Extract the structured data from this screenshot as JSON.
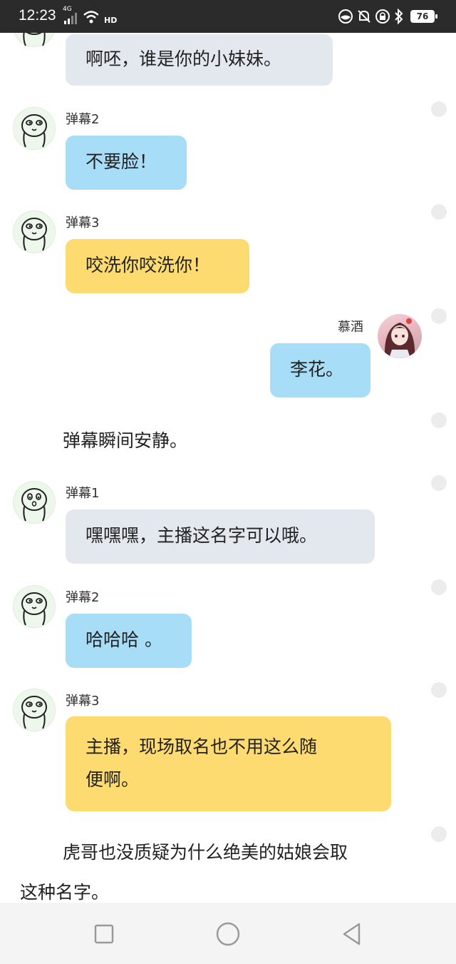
{
  "status_bar": {
    "time": "12:23",
    "network": "4G",
    "hd": "HD",
    "battery": "76"
  },
  "messages": [
    {
      "type": "bubble",
      "side": "left",
      "sender": "",
      "text": "啊呸，谁是你的小妹妹。",
      "color": "gray"
    },
    {
      "type": "bubble",
      "side": "left",
      "sender": "弹幕2",
      "text": "不要脸！",
      "color": "blue"
    },
    {
      "type": "bubble",
      "side": "left",
      "sender": "弹幕3",
      "text": "咬洗你咬洗你！",
      "color": "yellow"
    },
    {
      "type": "bubble",
      "side": "right",
      "sender": "慕酒",
      "text": "李花。",
      "color": "blue"
    },
    {
      "type": "narration",
      "text": "弹幕瞬间安静。"
    },
    {
      "type": "bubble",
      "side": "left",
      "sender": "弹幕1",
      "text": "嘿嘿嘿，主播这名字可以哦。",
      "color": "gray"
    },
    {
      "type": "bubble",
      "side": "left",
      "sender": "弹幕2",
      "text": "哈哈哈 。",
      "color": "blue"
    },
    {
      "type": "bubble",
      "side": "left",
      "sender": "弹幕3",
      "text_line1": "主播，现场取名也不用这么随",
      "text_line2": "便啊。",
      "color": "yellow"
    },
    {
      "type": "narration",
      "text_line1": "虎哥也没质疑为什么绝美的姑娘会取",
      "text_line2": "这种名字。"
    }
  ],
  "colors": {
    "gray_bubble": "#e3e8ef",
    "blue_bubble": "#a8ddf8",
    "yellow_bubble": "#fddb70",
    "status_bar": "#2b2b2b",
    "nav_bar": "#f4f4f4"
  },
  "nav_bar": {
    "icons": [
      "recent-apps-square-icon",
      "home-circle-icon",
      "back-triangle-icon"
    ]
  }
}
